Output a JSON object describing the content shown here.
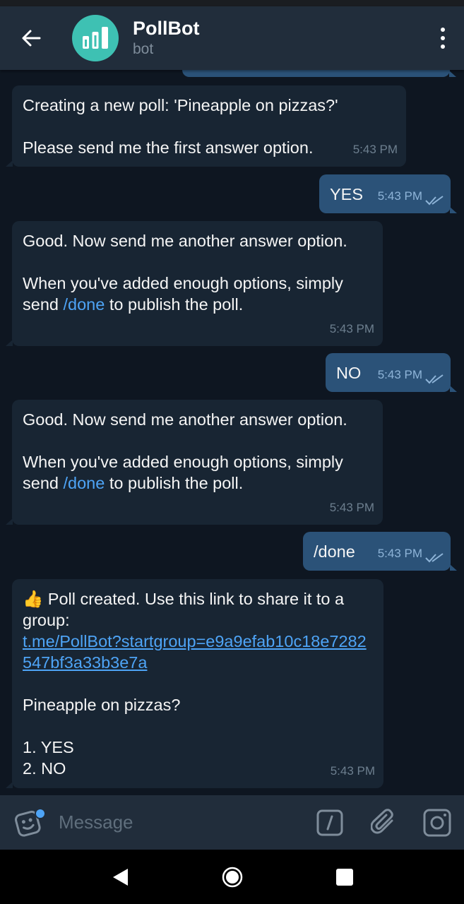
{
  "header": {
    "title": "PollBot",
    "subtitle": "bot",
    "avatar_color": "#3ec1b3",
    "icons": {
      "back": "arrow-left-icon",
      "avatar": "poll-chart-icon",
      "menu": "more-vertical-icon"
    }
  },
  "messages": [
    {
      "text_a": "Creating a new poll: 'Pineapple on pizzas?'",
      "text_b": "Please send me the first answer option.",
      "time": "5:43 PM"
    },
    {
      "text": "YES",
      "time": "5:43 PM"
    },
    {
      "text_a": "Good. Now send me another answer option.",
      "text_b1": "When you've added enough options, simply send ",
      "command": "/done",
      "text_b2": " to publish the poll.",
      "time": "5:43 PM"
    },
    {
      "text": "NO",
      "time": "5:43 PM"
    },
    {
      "text_a": "Good. Now send me another answer option.",
      "text_b1": "When you've added enough options, simply send ",
      "command": "/done",
      "text_b2": " to publish the poll.",
      "time": "5:43 PM"
    },
    {
      "text": "/done",
      "time": "5:43 PM"
    },
    {
      "emoji": "👍",
      "text_a": " Poll created. Use this link to share it to a group:",
      "link": "t.me/PollBot?startgroup=e9a9efab10c18e7282547bf3a33b3e7a",
      "question": "Pineapple on pizzas?",
      "option1": "1. YES",
      "option2": "2. NO",
      "time": "5:43 PM"
    }
  ],
  "composer": {
    "placeholder": "Message",
    "icons": {
      "emoji": "sticker-icon",
      "command": "bot-command-icon",
      "attach": "paperclip-icon",
      "camera": "camera-icon"
    }
  },
  "navbar": {
    "icons": [
      "back-triangle-icon",
      "home-circle-icon",
      "recents-square-icon"
    ]
  },
  "colors": {
    "background": "#0e1621",
    "incoming_bubble": "#182533",
    "outgoing_bubble": "#2b5278",
    "accent": "#4ea4f6"
  }
}
